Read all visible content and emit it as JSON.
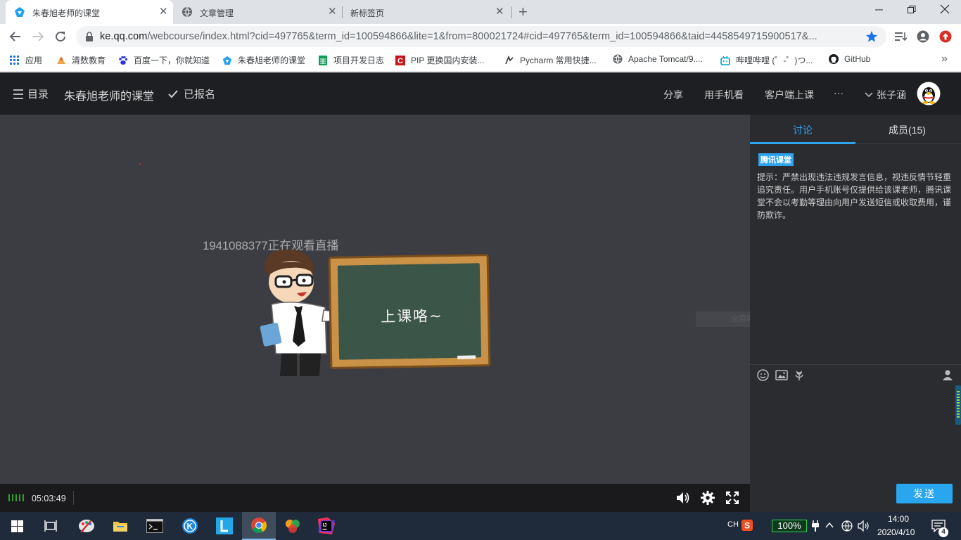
{
  "browser": {
    "tabs": [
      {
        "title": "朱春旭老师的课堂",
        "active": true
      },
      {
        "title": "文章管理",
        "active": false
      },
      {
        "title": "新标签页",
        "active": false
      }
    ],
    "url_host": "ke.qq.com",
    "url_path": "/webcourse/index.html?cid=497765&term_id=100594866&lite=1&from=800021724#cid=497765&term_id=100594866&taid=4458549715900517&..."
  },
  "bookmarks": [
    {
      "label": "应用",
      "icon": "apps-grid-icon"
    },
    {
      "label": "清数教育",
      "icon": "qingshu-icon"
    },
    {
      "label": "百度一下，你就知道",
      "icon": "baidu-paw-icon"
    },
    {
      "label": "朱春旭老师的课堂",
      "icon": "tencent-classroom-icon"
    },
    {
      "label": "项目开发日志",
      "icon": "sheets-icon"
    },
    {
      "label": "PIP 更换国内安装...",
      "icon": "csdn-icon"
    },
    {
      "label": "Pycharm 常用快捷...",
      "icon": "pycharm-icon"
    },
    {
      "label": "Apache Tomcat/9....",
      "icon": "globe-icon"
    },
    {
      "label": "哔哩哔哩 (゜-゜)つ...",
      "icon": "bilibili-icon"
    },
    {
      "label": "GitHub",
      "icon": "github-icon"
    }
  ],
  "page_header": {
    "menu_label": "目录",
    "course_title": "朱春旭老师的课堂",
    "enrolled_label": "已报名",
    "share_label": "分享",
    "mobile_label": "用手机看",
    "client_label": "客户端上课",
    "more_label": "···",
    "username": "张子涵"
  },
  "video": {
    "watching_text": "1941088377正在观看直播",
    "blackboard_text": "上课咯~",
    "snapshot_hint": "全屏幕截图(S)",
    "elapsed_time": "05:03:49"
  },
  "side_panel": {
    "tab_discussion": "讨论",
    "tab_members": "成员(15)",
    "brand_tag": "腾讯课堂",
    "notice_text": "提示：严禁出现违法违规发言信息，视违反情节轻重追究责任。用户手机账号仅提供给该课老师，腾讯课堂不会以考勤等理由向用户发送短信或收取费用，谨防欺诈。",
    "send_label": "发送"
  },
  "taskbar": {
    "input_method": "CH",
    "battery_label": "100%",
    "clock_time": "14:00",
    "clock_date": "2020/4/10",
    "notification_count": "4"
  },
  "colors": {
    "accent_blue": "#28a6ee",
    "header_dark": "#1e1f22",
    "video_bg": "#3b3d42",
    "panel_bg": "#2b2c30",
    "taskbar_bg": "#1f2b3a",
    "battery_green": "#2fd35a"
  }
}
